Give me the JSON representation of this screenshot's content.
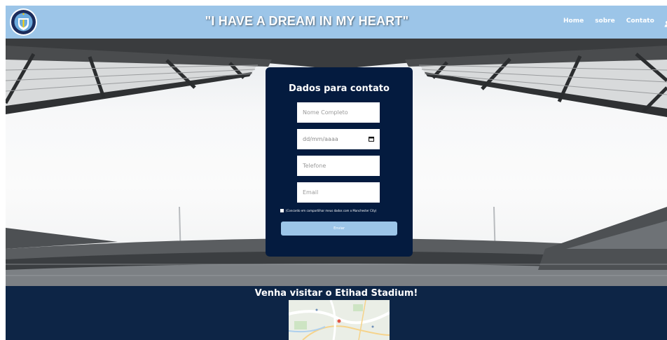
{
  "header": {
    "title": "\"I HAVE A DREAM IN MY HEART\"",
    "nav": [
      "Home",
      "sobre",
      "Contato"
    ],
    "crest_icon": "manchester-city-crest-icon",
    "user_icon": "user-icon",
    "background": "#9cc5e8"
  },
  "form": {
    "title": "Dados para contato",
    "name_placeholder": "Nome Completo",
    "date_placeholder": "dd/mm/aaaa",
    "phone_placeholder": "Telefone",
    "email_placeholder": "Email",
    "consent_label": "(Concordo em compartilhar meus dados com o Manchester City)",
    "submit_label": "Enviar",
    "background": "#041b3f",
    "accent": "#9cc5e8"
  },
  "footer": {
    "title": "Venha visitar o Etihad Stadium!",
    "background": "#0d2546"
  }
}
